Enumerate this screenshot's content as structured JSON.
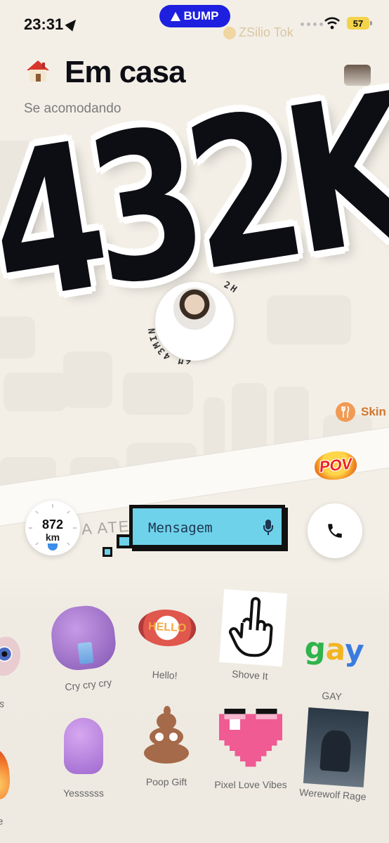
{
  "status_bar": {
    "time": "23:31",
    "app_pill": "BUMP",
    "battery": "57"
  },
  "map": {
    "poi_top": "ZSilio Tok",
    "poi_right": "Skin",
    "road_label": "A ATE"
  },
  "header": {
    "title": "Em casa",
    "subtitle": "Se acomodando"
  },
  "overlay": {
    "big_text": "432K"
  },
  "user_marker": {
    "duration": "2H 43MIN"
  },
  "pov_badge": "POV",
  "distance": {
    "value": "872",
    "unit": "km"
  },
  "message": {
    "placeholder": "Mensagem"
  },
  "stickers": [
    {
      "label": "nos",
      "icon": "eyeball-icon"
    },
    {
      "label": "Cry cry cry",
      "icon": "crying-purple-head-icon"
    },
    {
      "label": "Hello!",
      "icon": "hello-lips-icon",
      "art_text": "HELLO"
    },
    {
      "label": "Shove It",
      "icon": "middle-finger-hand-icon"
    },
    {
      "label": "GAY",
      "icon": "gay-text-icon",
      "art_text": "gay"
    },
    {
      "label": "re",
      "icon": "flame-icon"
    },
    {
      "label": "Yessssss",
      "icon": "thumbs-up-icon"
    },
    {
      "label": "Poop Gift",
      "icon": "poop-icon"
    },
    {
      "label": "Pixel Love Vibes",
      "icon": "pixel-heart-icon"
    },
    {
      "label": "Werewolf Rage",
      "icon": "werewolf-icon"
    }
  ],
  "colors": {
    "accent_blue": "#1f1fe0",
    "bubble": "#6ed2ea",
    "map_bg": "#f3efe7"
  }
}
